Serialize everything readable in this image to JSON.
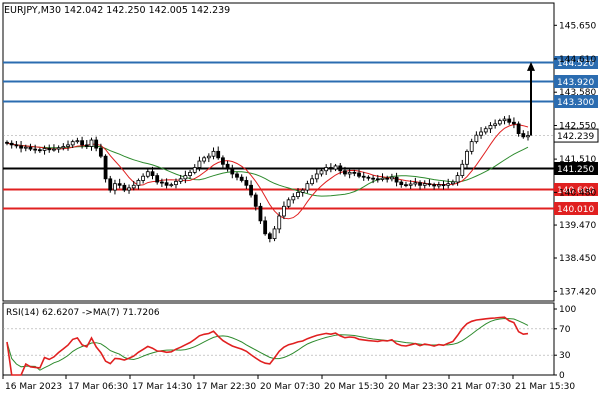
{
  "chart_data": {
    "type": "candlestick",
    "symbol_line": "EURJPY,M30  142.042 142.250 142.005 142.239",
    "price_axis": {
      "ticks": [
        {
          "label": "145.650",
          "value": 145.65
        },
        {
          "label": "144.610",
          "value": 144.61
        },
        {
          "label": "143.580",
          "value": 143.58
        },
        {
          "label": "142.550",
          "value": 142.55
        },
        {
          "label": "141.510",
          "value": 141.51
        },
        {
          "label": "140.480",
          "value": 140.48
        },
        {
          "label": "139.470",
          "value": 139.47
        },
        {
          "label": "138.450",
          "value": 138.45
        },
        {
          "label": "137.420",
          "value": 137.42
        }
      ],
      "current_price": {
        "label": "142.239",
        "value": 142.239
      }
    },
    "levels": [
      {
        "label": "144.520",
        "value": 144.52,
        "color": "#2b6cb0"
      },
      {
        "label": "143.920",
        "value": 143.92,
        "color": "#2b6cb0"
      },
      {
        "label": "143.300",
        "value": 143.3,
        "color": "#2b6cb0"
      },
      {
        "label": "141.250",
        "value": 141.25,
        "color": "#000000"
      },
      {
        "label": "140.600",
        "value": 140.6,
        "color": "#e02020"
      },
      {
        "label": "140.010",
        "value": 140.01,
        "color": "#e02020"
      }
    ],
    "time_axis": [
      "16 Mar 2023",
      "17 Mar 06:30",
      "17 Mar 14:30",
      "17 Mar 22:30",
      "20 Mar 07:30",
      "20 Mar 15:30",
      "20 Mar 23:30",
      "21 Mar 07:30",
      "21 Mar 15:30"
    ],
    "closes": [
      142.0,
      141.95,
      141.92,
      141.85,
      141.88,
      141.82,
      141.8,
      141.78,
      141.84,
      141.8,
      141.82,
      141.86,
      141.9,
      141.95,
      142.05,
      142.08,
      141.95,
      141.9,
      142.1,
      141.85,
      141.6,
      140.9,
      140.55,
      140.75,
      140.7,
      140.55,
      140.62,
      140.7,
      140.85,
      140.98,
      141.12,
      141.0,
      140.8,
      140.78,
      140.7,
      140.72,
      140.82,
      140.9,
      141.0,
      141.1,
      141.25,
      141.45,
      141.55,
      141.6,
      141.75,
      141.55,
      141.35,
      141.2,
      141.05,
      140.95,
      140.85,
      140.7,
      140.4,
      140.05,
      139.6,
      139.2,
      139.05,
      139.35,
      139.75,
      140.05,
      140.25,
      140.35,
      140.48,
      140.55,
      140.75,
      140.9,
      141.05,
      141.15,
      141.25,
      141.2,
      141.3,
      141.15,
      141.05,
      141.1,
      141.08,
      140.98,
      140.95,
      140.92,
      140.9,
      140.88,
      140.92,
      140.9,
      140.95,
      140.8,
      140.72,
      140.7,
      140.74,
      140.78,
      140.7,
      140.75,
      140.72,
      140.68,
      140.72,
      140.7,
      140.75,
      140.8,
      141.0,
      141.35,
      141.75,
      142.05,
      142.25,
      142.35,
      142.45,
      142.55,
      142.6,
      142.7,
      142.75,
      142.65,
      142.6,
      142.3,
      142.2,
      142.239
    ],
    "ma_fast_color": "#e02020",
    "ma_slow_color": "#2e8b2e",
    "arrow": {
      "from": 142.239,
      "to": 144.52
    },
    "rsi": {
      "label": "RSI(14) 62.6207  ->MA(7) 71.7206",
      "ticks": [
        {
          "label": "100",
          "value": 100
        },
        {
          "label": "70",
          "value": 70
        },
        {
          "label": "30",
          "value": 30
        },
        {
          "label": "0",
          "value": 0
        }
      ],
      "ylim": [
        0,
        100
      ],
      "rsi_color": "#e02020",
      "ma_color": "#2e8b2e"
    }
  }
}
